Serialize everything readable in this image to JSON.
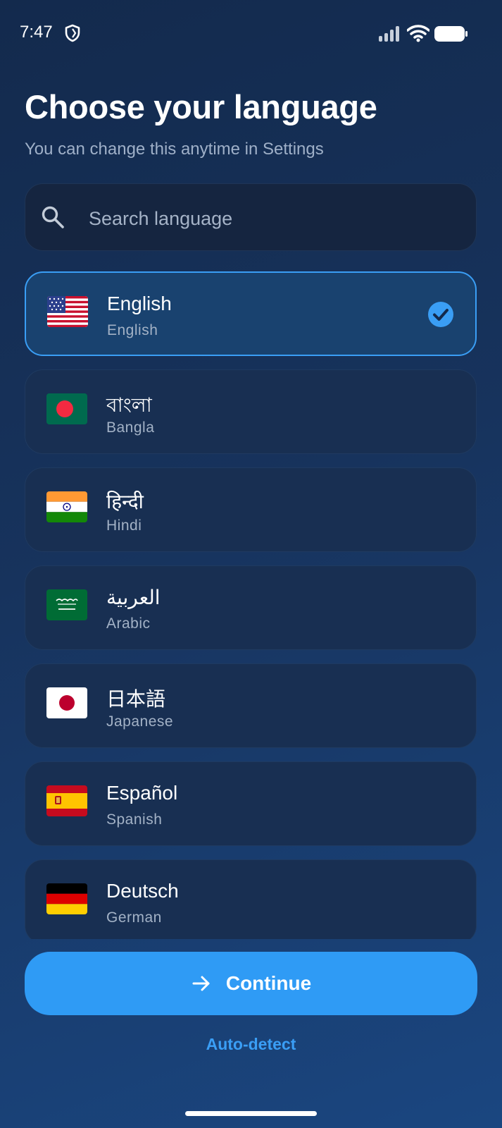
{
  "status_bar": {
    "time": "7:47"
  },
  "page": {
    "title": "Choose your language",
    "subtitle": "You can change this anytime in Settings"
  },
  "search": {
    "placeholder": "Search language",
    "value": ""
  },
  "languages": [
    {
      "native": "English",
      "english": "English",
      "flag": "us-flag-icon",
      "selected": true
    },
    {
      "native": "বাংলা",
      "english": "Bangla",
      "flag": "bangladesh-flag-icon",
      "selected": false
    },
    {
      "native": "हिन्दी",
      "english": "Hindi",
      "flag": "india-flag-icon",
      "selected": false
    },
    {
      "native": "العربية",
      "english": "Arabic",
      "flag": "saudi-flag-icon",
      "selected": false
    },
    {
      "native": "日本語",
      "english": "Japanese",
      "flag": "japan-flag-icon",
      "selected": false
    },
    {
      "native": "Español",
      "english": "Spanish",
      "flag": "spain-flag-icon",
      "selected": false
    },
    {
      "native": "Deutsch",
      "english": "German",
      "flag": "germany-flag-icon",
      "selected": false
    }
  ],
  "actions": {
    "continue_label": "Continue",
    "auto_detect_label": "Auto-detect"
  },
  "colors": {
    "accent": "#2f9bf5",
    "selected_border": "#3a9ef5",
    "card_bg": "#182f52",
    "background": "#17335d"
  }
}
